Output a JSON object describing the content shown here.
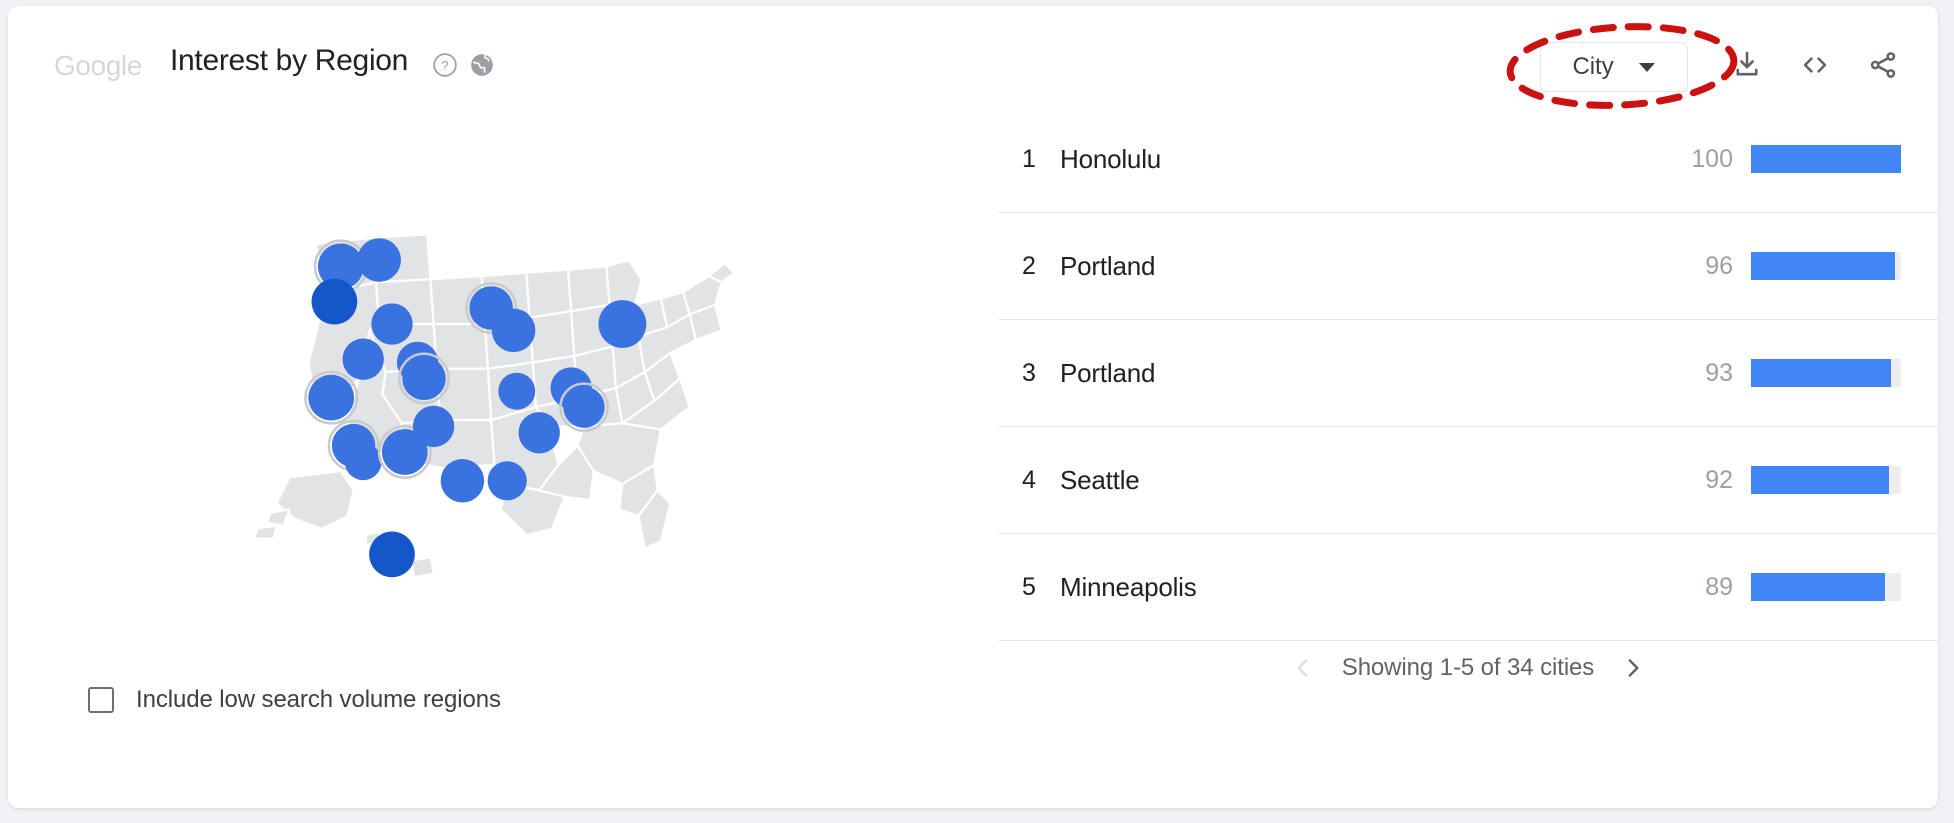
{
  "background_color": "#f1f1f6",
  "card": {
    "background": "#ffffff"
  },
  "header": {
    "brand": "Google",
    "title": "Interest by Region",
    "help_icon": "help-circle-icon",
    "globe_icon": "globe-icon",
    "dropdown": {
      "selected": "City",
      "caret_icon": "chevron-down-icon",
      "annotated": true,
      "annotation_color": "#cc1111"
    },
    "actions": [
      {
        "name": "download-icon",
        "label": "Download"
      },
      {
        "name": "embed-icon",
        "label": "<>"
      },
      {
        "name": "share-icon",
        "label": "Share"
      }
    ]
  },
  "map": {
    "region": "United States",
    "land_color": "#e2e3e5",
    "border_color": "#ffffff",
    "marker_color": "#3a72e0",
    "marker_color_top": "#1557c8",
    "markers": [
      {
        "x": 34,
        "y": 22,
        "r": 21,
        "ring": true,
        "shade": "mid"
      },
      {
        "x": 46,
        "y": 20,
        "r": 20,
        "ring": false,
        "shade": "mid"
      },
      {
        "x": 32,
        "y": 33,
        "r": 21,
        "ring": false,
        "shade": "dark"
      },
      {
        "x": 50,
        "y": 40,
        "r": 19,
        "ring": false,
        "shade": "mid"
      },
      {
        "x": 31,
        "y": 63,
        "r": 21,
        "ring": true,
        "shade": "mid"
      },
      {
        "x": 41,
        "y": 51,
        "r": 19,
        "ring": false,
        "shade": "mid"
      },
      {
        "x": 38,
        "y": 78,
        "r": 20,
        "ring": true,
        "shade": "mid"
      },
      {
        "x": 41,
        "y": 83,
        "r": 17,
        "ring": false,
        "shade": "mid"
      },
      {
        "x": 54,
        "y": 80,
        "r": 21,
        "ring": true,
        "shade": "mid"
      },
      {
        "x": 58,
        "y": 52,
        "r": 19,
        "ring": false,
        "shade": "mid"
      },
      {
        "x": 60,
        "y": 57,
        "r": 20,
        "ring": true,
        "shade": "mid"
      },
      {
        "x": 63,
        "y": 72,
        "r": 19,
        "ring": false,
        "shade": "mid"
      },
      {
        "x": 72,
        "y": 89,
        "r": 20,
        "ring": false,
        "shade": "mid"
      },
      {
        "x": 86,
        "y": 89,
        "r": 18,
        "ring": false,
        "shade": "mid"
      },
      {
        "x": 81,
        "y": 35,
        "r": 20,
        "ring": true,
        "shade": "mid"
      },
      {
        "x": 88,
        "y": 42,
        "r": 20,
        "ring": false,
        "shade": "mid"
      },
      {
        "x": 89,
        "y": 61,
        "r": 17,
        "ring": false,
        "shade": "mid"
      },
      {
        "x": 96,
        "y": 74,
        "r": 19,
        "ring": false,
        "shade": "mid"
      },
      {
        "x": 106,
        "y": 60,
        "r": 19,
        "ring": false,
        "shade": "mid"
      },
      {
        "x": 110,
        "y": 66,
        "r": 19,
        "ring": true,
        "shade": "mid"
      },
      {
        "x": 122,
        "y": 40,
        "r": 22,
        "ring": false,
        "shade": "mid"
      },
      {
        "x": 50,
        "y": 112,
        "r": 21,
        "ring": false,
        "shade": "dark"
      }
    ],
    "low_volume_toggle": {
      "label": "Include low search volume regions",
      "checked": false
    }
  },
  "chart_data": {
    "type": "bar",
    "title": "Interest by Region",
    "xlabel": "",
    "ylabel": "",
    "ylim": [
      0,
      100
    ],
    "categories": [
      "Honolulu",
      "Portland",
      "Portland",
      "Seattle",
      "Minneapolis"
    ],
    "values": [
      100,
      96,
      93,
      92,
      89
    ],
    "ranks": [
      1,
      2,
      3,
      4,
      5
    ],
    "bar_color": "#4285f4",
    "track_color": "#eeeeee",
    "grid": false,
    "legend": false
  },
  "list": {
    "rows": [
      {
        "rank": "1",
        "name": "Honolulu",
        "value": "100",
        "pct": 100
      },
      {
        "rank": "2",
        "name": "Portland",
        "value": "96",
        "pct": 96
      },
      {
        "rank": "3",
        "name": "Portland",
        "value": "93",
        "pct": 93
      },
      {
        "rank": "4",
        "name": "Seattle",
        "value": "92",
        "pct": 92
      },
      {
        "rank": "5",
        "name": "Minneapolis",
        "value": "89",
        "pct": 89
      }
    ]
  },
  "pagination": {
    "text": "Showing 1-5 of 34 cities",
    "prev_icon": "chevron-left-icon",
    "next_icon": "chevron-right-icon",
    "prev_enabled": false,
    "next_enabled": true
  }
}
